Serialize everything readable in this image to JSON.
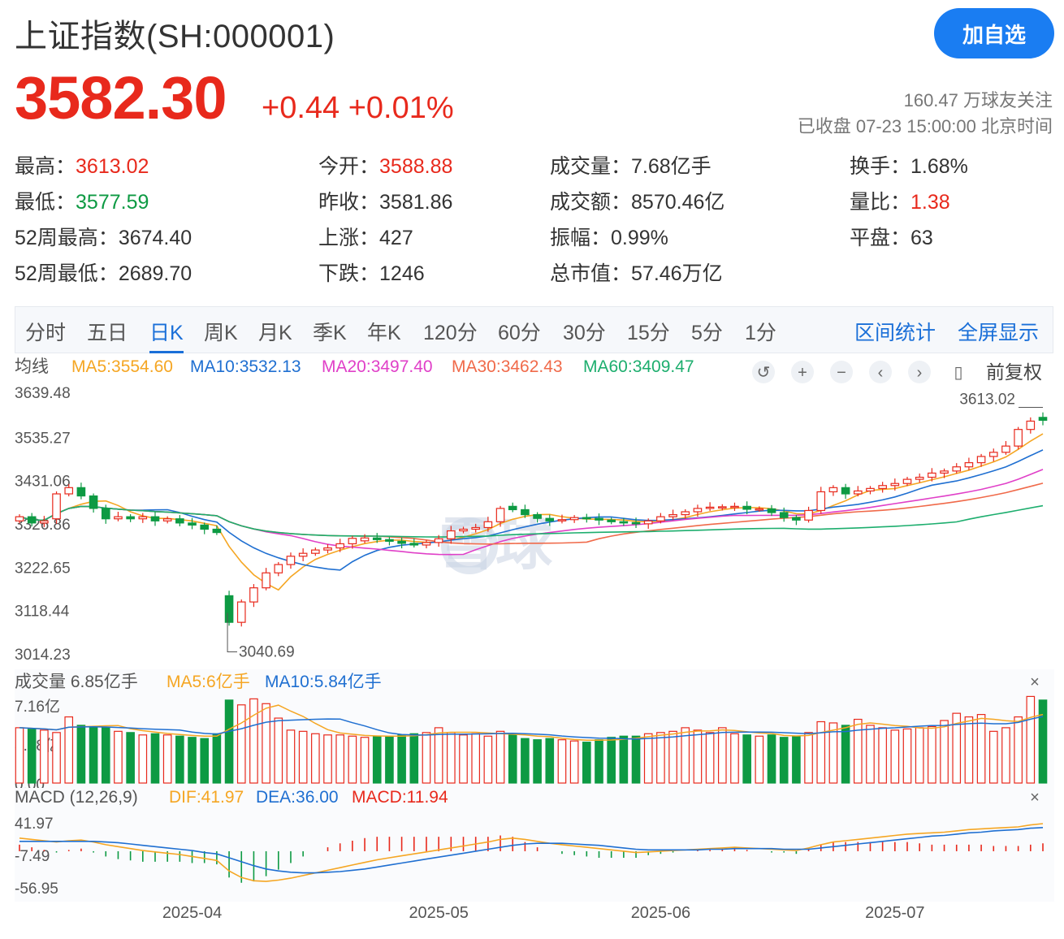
{
  "header": {
    "title": "上证指数(SH:000001)",
    "follow_button": "加自选",
    "price": "3582.30",
    "change": "+0.44 +0.01%",
    "followers": "160.47 万球友关注",
    "status": "已收盘 07-23 15:00:00 北京时间"
  },
  "stats": [
    {
      "label": "最高：",
      "value": "3613.02",
      "tone": "red"
    },
    {
      "label": "今开：",
      "value": "3588.88",
      "tone": "red"
    },
    {
      "label": "成交量：",
      "value": "7.68亿手",
      "tone": ""
    },
    {
      "label": "换手：",
      "value": "1.68%",
      "tone": ""
    },
    {
      "label": "最低：",
      "value": "3577.59",
      "tone": "green"
    },
    {
      "label": "昨收：",
      "value": "3581.86",
      "tone": ""
    },
    {
      "label": "成交额：",
      "value": "8570.46亿",
      "tone": ""
    },
    {
      "label": "量比：",
      "value": "1.38",
      "tone": "red"
    },
    {
      "label": "52周最高：",
      "value": "3674.40",
      "tone": ""
    },
    {
      "label": "上涨：",
      "value": "427",
      "tone": ""
    },
    {
      "label": "振幅：",
      "value": "0.99%",
      "tone": ""
    },
    {
      "label": "平盘：",
      "value": "63",
      "tone": ""
    },
    {
      "label": "52周最低：",
      "value": "2689.70",
      "tone": ""
    },
    {
      "label": "下跌：",
      "value": "1246",
      "tone": ""
    },
    {
      "label": "总市值：",
      "value": "57.46万亿",
      "tone": ""
    }
  ],
  "tabs": [
    "分时",
    "五日",
    "日K",
    "周K",
    "月K",
    "季K",
    "年K",
    "120分",
    "60分",
    "30分",
    "15分",
    "5分",
    "1分"
  ],
  "active_tab": "日K",
  "tab_actions": [
    "区间统计",
    "全屏显示"
  ],
  "colors": {
    "up": "#e8291c",
    "down": "#0d9a43",
    "accent": "#1a7df2",
    "ma5": "#f5a623",
    "ma10": "#1f6fd1",
    "ma20": "#e040c8",
    "ma30": "#f06a4a",
    "ma60": "#1dae6e"
  },
  "chart_data": [
    {
      "type": "candlestick",
      "legend_label": "均线",
      "legend": [
        {
          "name": "MA5",
          "value": "3554.60",
          "color": "#f5a623"
        },
        {
          "name": "MA10",
          "value": "3532.13",
          "color": "#1f6fd1"
        },
        {
          "name": "MA20",
          "value": "3497.40",
          "color": "#e040c8"
        },
        {
          "name": "MA30",
          "value": "3462.43",
          "color": "#f06a4a"
        },
        {
          "name": "MA60",
          "value": "3409.47",
          "color": "#1dae6e"
        }
      ],
      "adjust_label": "前复权",
      "y_ticks": [
        "3639.48",
        "3535.27",
        "3431.06",
        "3326.86",
        "3222.65",
        "3118.44",
        "3014.23"
      ],
      "ylim": [
        3014.23,
        3639.48
      ],
      "max_marker": "3613.02",
      "min_marker": "3040.69",
      "x_ticks": [
        "2025-04",
        "2025-05",
        "2025-06",
        "2025-07"
      ],
      "x_tick_index": [
        14,
        34,
        52,
        71
      ],
      "closes": [
        3350,
        3335,
        3340,
        3405,
        3420,
        3400,
        3370,
        3345,
        3350,
        3345,
        3350,
        3340,
        3345,
        3335,
        3330,
        3320,
        3312,
        3096,
        3145,
        3179,
        3215,
        3235,
        3255,
        3262,
        3270,
        3275,
        3285,
        3298,
        3299,
        3295,
        3291,
        3286,
        3282,
        3288,
        3297,
        3316,
        3320,
        3324,
        3338,
        3370,
        3367,
        3355,
        3346,
        3340,
        3343,
        3348,
        3346,
        3342,
        3338,
        3336,
        3333,
        3340,
        3350,
        3355,
        3362,
        3370,
        3373,
        3374,
        3375,
        3368,
        3369,
        3360,
        3348,
        3342,
        3365,
        3410,
        3420,
        3405,
        3412,
        3418,
        3425,
        3430,
        3440,
        3445,
        3455,
        3460,
        3470,
        3480,
        3495,
        3505,
        3520,
        3560,
        3580,
        3582
      ],
      "opens": [
        3340,
        3350,
        3335,
        3345,
        3405,
        3420,
        3400,
        3370,
        3345,
        3350,
        3345,
        3350,
        3340,
        3345,
        3335,
        3330,
        3320,
        3160,
        3096,
        3145,
        3179,
        3215,
        3235,
        3255,
        3262,
        3270,
        3275,
        3285,
        3292,
        3299,
        3295,
        3291,
        3286,
        3282,
        3288,
        3297,
        3316,
        3320,
        3324,
        3338,
        3375,
        3367,
        3355,
        3346,
        3340,
        3343,
        3348,
        3346,
        3342,
        3338,
        3336,
        3333,
        3340,
        3350,
        3355,
        3362,
        3370,
        3373,
        3374,
        3375,
        3368,
        3369,
        3360,
        3348,
        3342,
        3365,
        3410,
        3420,
        3405,
        3412,
        3418,
        3425,
        3430,
        3440,
        3445,
        3455,
        3460,
        3470,
        3480,
        3495,
        3505,
        3520,
        3560,
        3589
      ]
    },
    {
      "type": "bar",
      "name": "成交量",
      "value": "6.85亿手",
      "legend": [
        {
          "name": "MA5",
          "value": "6亿手",
          "color": "#f5a623"
        },
        {
          "name": "MA10",
          "value": "5.84亿手",
          "color": "#1f6fd1"
        }
      ],
      "y_ticks": [
        "7.16亿",
        "3.58亿",
        "0.00"
      ],
      "ylim": [
        0,
        7.16
      ],
      "unit": "亿手",
      "values": [
        4.6,
        4.5,
        4.4,
        4.2,
        5.5,
        4.8,
        4.7,
        4.6,
        4.3,
        4.2,
        4.0,
        4.1,
        4.0,
        3.9,
        3.8,
        3.7,
        4.1,
        6.9,
        6.5,
        7.0,
        6.6,
        5.4,
        4.4,
        4.3,
        4.1,
        4.0,
        4.0,
        3.9,
        3.8,
        3.9,
        3.9,
        4.0,
        4.1,
        4.2,
        4.6,
        4.2,
        4.0,
        4.1,
        3.9,
        4.3,
        4.0,
        3.7,
        3.6,
        3.7,
        3.6,
        3.5,
        3.4,
        3.6,
        3.8,
        3.9,
        3.9,
        4.1,
        4.2,
        4.3,
        4.6,
        4.4,
        4.2,
        4.6,
        4.1,
        4.0,
        3.9,
        4.0,
        3.8,
        3.9,
        4.2,
        5.1,
        5.0,
        4.8,
        5.3,
        4.8,
        4.6,
        4.4,
        4.5,
        4.6,
        4.7,
        5.2,
        5.8,
        5.5,
        5.7,
        4.3,
        4.6,
        5.5,
        7.2,
        6.9
      ]
    },
    {
      "type": "macd",
      "title": "MACD (12,26,9)",
      "legend": [
        {
          "name": "DIF",
          "value": "41.97",
          "color": "#f5a623"
        },
        {
          "name": "DEA",
          "value": "36.00",
          "color": "#1f6fd1"
        },
        {
          "name": "MACD",
          "value": "11.94",
          "color": "#e8291c"
        }
      ],
      "y_ticks": [
        "41.97",
        "-7.49",
        "-56.95"
      ],
      "ylim": [
        -56.95,
        41.97
      ],
      "dif": [
        20,
        18,
        16,
        14,
        16,
        17,
        14,
        10,
        7,
        4,
        1,
        -1,
        -3,
        -5,
        -8,
        -11,
        -14,
        -30,
        -40,
        -45,
        -46,
        -44,
        -41,
        -37,
        -33,
        -29,
        -25,
        -21,
        -17,
        -13,
        -10,
        -7,
        -4,
        -1,
        2,
        5,
        8,
        11,
        14,
        18,
        20,
        18,
        15,
        12,
        10,
        8,
        6,
        4,
        2,
        0,
        -2,
        -1,
        0,
        1,
        2,
        3,
        4,
        5,
        6,
        5,
        4,
        3,
        2,
        1,
        5,
        10,
        14,
        16,
        18,
        20,
        22,
        24,
        26,
        27,
        28,
        29,
        31,
        33,
        34,
        35,
        36,
        37,
        40,
        42
      ],
      "dea": [
        15,
        15,
        15,
        15,
        15,
        15,
        15,
        14,
        13,
        11,
        9,
        7,
        5,
        3,
        1,
        -2,
        -4,
        -10,
        -16,
        -22,
        -27,
        -30,
        -32,
        -33,
        -33,
        -32,
        -31,
        -29,
        -27,
        -24,
        -21,
        -18,
        -15,
        -12,
        -9,
        -6,
        -3,
        0,
        3,
        6,
        9,
        11,
        12,
        12,
        12,
        11,
        10,
        9,
        7,
        5,
        3,
        2,
        2,
        2,
        2,
        2,
        3,
        3,
        4,
        4,
        4,
        4,
        3,
        3,
        3,
        5,
        7,
        9,
        11,
        13,
        15,
        17,
        19,
        21,
        23,
        24,
        26,
        28,
        29,
        31,
        32,
        33,
        35,
        36
      ],
      "macd": [
        10,
        6,
        2,
        -2,
        2,
        4,
        -2,
        -8,
        -12,
        -14,
        -16,
        -16,
        -16,
        -16,
        -18,
        -18,
        -20,
        -40,
        -48,
        -46,
        -38,
        -28,
        -18,
        -8,
        0,
        6,
        12,
        16,
        20,
        22,
        22,
        22,
        22,
        22,
        22,
        22,
        22,
        22,
        22,
        24,
        22,
        14,
        6,
        0,
        -4,
        -6,
        -8,
        -10,
        -10,
        -10,
        -10,
        -6,
        -4,
        -2,
        0,
        2,
        2,
        4,
        4,
        2,
        0,
        -2,
        -2,
        -4,
        4,
        10,
        14,
        14,
        14,
        14,
        14,
        14,
        14,
        12,
        10,
        10,
        10,
        10,
        10,
        8,
        8,
        8,
        10,
        12
      ]
    }
  ],
  "watermark": "雪球"
}
